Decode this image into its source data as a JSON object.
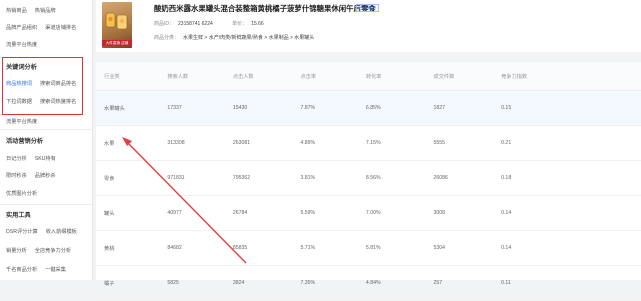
{
  "sidebar": {
    "rows": [
      [
        "热销商品",
        "热销品牌"
      ],
      [
        "品牌产品组织",
        "渠道店铺排名"
      ],
      [
        "流量平台热度"
      ]
    ],
    "section_keywords": {
      "title": "关键词分析",
      "rows": [
        [
          "商品热搜词",
          "搜索词商品排名"
        ],
        [
          "下拉词数据",
          "搜索词热度排名"
        ]
      ]
    },
    "after_keywords": [
      "流量平台热度"
    ],
    "section_campaign": {
      "title": "活动营销分析",
      "rows": [
        [
          "日记分析",
          "SKU持有"
        ],
        [
          "限时秒杀",
          "品牌秒杀"
        ],
        [
          "优质图片分析"
        ]
      ]
    },
    "section_tools": {
      "title": "实用工具",
      "rows": [
        [
          "DSR评分计算",
          "收入前缀模板"
        ],
        [
          "销量分析",
          "全店竞争力分析"
        ],
        [
          "千名商品分析",
          "一键采集"
        ]
      ]
    }
  },
  "product": {
    "title": "酸奶西米露水果罐头混合装整箱黄桃橘子菠萝什锦糖果休闲午后零食",
    "badge": "已收藏此",
    "thumb_tag": "大件直销 店铺",
    "meta": {
      "id_label": "商品ID：",
      "id_value": "23158741 6224",
      "price_label": "单价：",
      "price_value": "15.66"
    },
    "category": {
      "label": "商品分类：",
      "value": "水果生鲜 > 水产/肉类/新鲜蔬果/熟食 > 水果制品 > 水果罐头"
    }
  },
  "table": {
    "headers": [
      "行业类",
      "搜索人数",
      "点击人数",
      "点击率",
      "转化率",
      "成交件数",
      "竞争力指数"
    ],
    "rows": [
      [
        "水果罐头",
        "17337",
        "15430",
        "7.87%",
        "6.85%",
        "1827",
        "0.15"
      ],
      [
        "水果",
        "313308",
        "263081",
        "4.89%",
        "7.15%",
        "5555",
        "0.21"
      ],
      [
        "零食",
        "971831",
        "795362",
        "3.81%",
        "8.56%",
        "26086",
        "0.18"
      ],
      [
        "罐头",
        "40977",
        "26784",
        "5.59%",
        "7.00%",
        "3008",
        "0.14"
      ],
      [
        "黄桃",
        "84682",
        "85835",
        "5.71%",
        "5.81%",
        "5304",
        "0.14"
      ],
      [
        "橘子",
        "5825",
        "3824",
        "7.35%",
        "4.84%",
        "257",
        "0.11"
      ]
    ]
  },
  "colors": {
    "accent": "#2f6fde",
    "highlight_box": "#e0303a",
    "arrow": "#e04040"
  }
}
